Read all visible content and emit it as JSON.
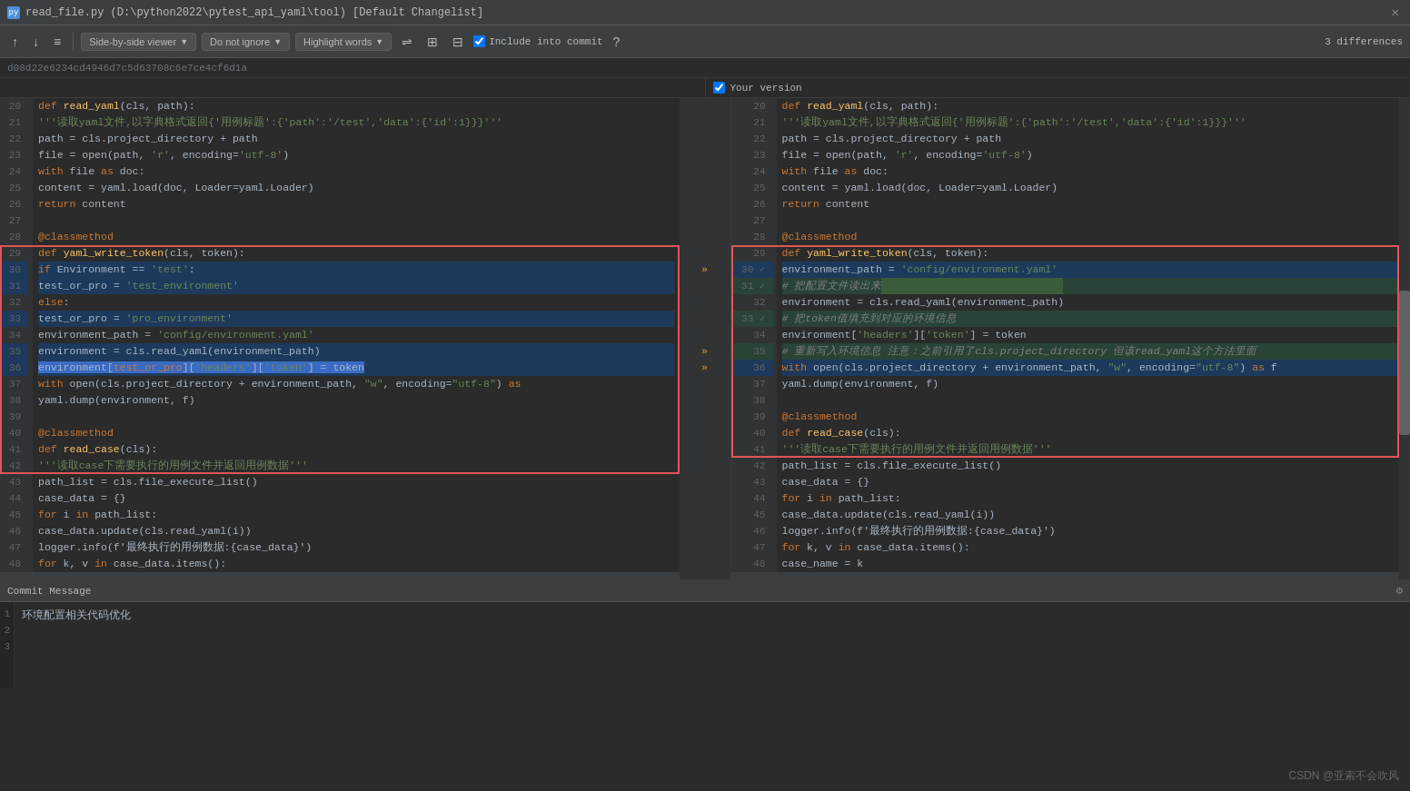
{
  "titlebar": {
    "icon": "py",
    "title": "read_file.py (D:\\python2022\\pytest_api_yaml\\tool) [Default Changelist]",
    "close": "✕"
  },
  "toolbar": {
    "nav_up": "↑",
    "nav_down": "↓",
    "nav_settings": "≡",
    "viewer_label": "Side-by-side viewer",
    "ignore_label": "Do not ignore",
    "highlight_label": "Highlight words",
    "icon1": "⇌",
    "icon2": "⊞",
    "icon3": "⊟",
    "include_checkbox": "Include into commit",
    "help": "?",
    "diff_count": "3 differences"
  },
  "hash": "d08d22e6234cd4946d7c5d63708c6e7ce4cf6d1a",
  "right_version": "Your version",
  "left_lines": {
    "numbers": [
      20,
      21,
      22,
      23,
      24,
      25,
      26,
      27,
      28,
      29,
      30,
      31,
      32,
      33,
      34,
      35,
      36,
      37,
      38,
      39,
      40,
      41,
      42,
      43,
      44,
      45,
      46,
      47,
      48
    ]
  },
  "right_lines": {
    "numbers": [
      20,
      21,
      22,
      23,
      24,
      25,
      26,
      27,
      28,
      29,
      30,
      31,
      32,
      33,
      34,
      35,
      36,
      37,
      38,
      39,
      40,
      41,
      42,
      43,
      44,
      45,
      46,
      47,
      48
    ]
  },
  "commit": {
    "title": "Commit Message",
    "message": "环境配置相关代码优化"
  },
  "watermark": "CSDN @亚索不会吹风"
}
